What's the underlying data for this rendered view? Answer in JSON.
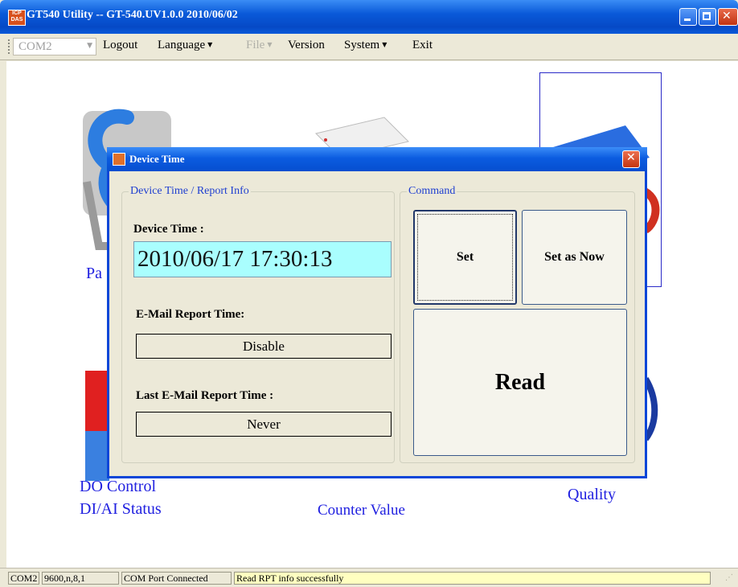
{
  "window": {
    "title": "GT540 Utility -- GT-540.UV1.0.0 2010/06/02"
  },
  "menubar": {
    "com_port": "COM2",
    "items": [
      {
        "label": "Logout",
        "has_arrow": false,
        "enabled": true
      },
      {
        "label": "Language",
        "has_arrow": true,
        "enabled": true
      },
      {
        "label": "File",
        "has_arrow": true,
        "enabled": false
      },
      {
        "label": "Version",
        "has_arrow": false,
        "enabled": true
      },
      {
        "label": "System",
        "has_arrow": true,
        "enabled": true
      },
      {
        "label": "Exit",
        "has_arrow": false,
        "enabled": true
      }
    ]
  },
  "main": {
    "labels": {
      "pa": "Pa",
      "do_control": "DO Control",
      "di_ai_status": "DI/AI Status",
      "counter_value": "Counter Value",
      "quality": "Quality"
    }
  },
  "dialog": {
    "title": "Device Time",
    "info_group": "Device Time / Report Info",
    "device_time_label": "Device Time :",
    "device_time_value": "2010/06/17 17:30:13",
    "email_report_label": "E-Mail Report Time:",
    "email_report_value": "Disable",
    "last_email_label": "Last E-Mail Report Time :",
    "last_email_value": "Never",
    "command_group": "Command",
    "set_label": "Set",
    "set_now_label": "Set as Now",
    "read_label": "Read"
  },
  "statusbar": {
    "port": "COM2",
    "settings": "9600,n,8,1",
    "connection": "COM Port Connected",
    "message": "Read RPT info successfully"
  },
  "colors": {
    "title_blue": "#0a5ad9",
    "label_blue": "#2020e0",
    "time_bg": "#a9fefe",
    "status_msg_bg": "#ffffc0"
  }
}
